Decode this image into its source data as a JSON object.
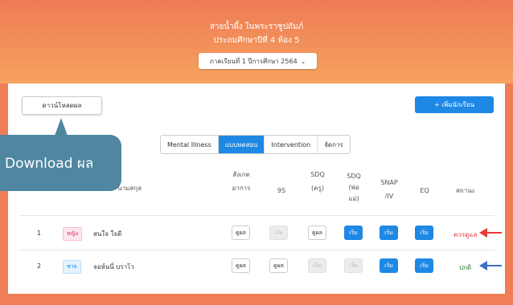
{
  "header": {
    "school": "สายน้ำผึ้ง ในพระราชูปถัมภ์",
    "class": "ประถมศึกษาปีที่ 4 ห้อง 5",
    "semester": "ภาคเรียนที่ 1 ปีการศึกษา 2564",
    "semester_caret": "⌄"
  },
  "toolbar": {
    "download_label": "ดาวน์โหลดผล",
    "add_label": "+  เพิ่มนักเรียน"
  },
  "callout": {
    "text": "Download ผล"
  },
  "tabs": [
    "Mental Illness",
    "แบบทดสอบ",
    "Intervention",
    "จัดการ"
  ],
  "columns": {
    "name": "ชื่อ-นามสกุล",
    "observe": [
      "สังเกต",
      "อาการ"
    ],
    "9s": "9S",
    "sdq_t": [
      "SDQ",
      "(ครู)"
    ],
    "sdq_p": [
      "SDQ",
      "(พ่อ",
      "แม่)"
    ],
    "snap": [
      "SNAP",
      "/IV"
    ],
    "eq": "EQ",
    "status": "สถานะ"
  },
  "rows": [
    {
      "no": "1",
      "gender": "หญิง",
      "name": "สนใจ ใจดี",
      "b": [
        "ดูผล",
        "เริ่ม",
        "ดูผล",
        "เริ่ม",
        "เริ่ม",
        "เริ่ม"
      ],
      "status": "ควรดูแล"
    },
    {
      "no": "2",
      "gender": "ชาย",
      "name": "จอห์นนี่ บราโว",
      "b": [
        "ดูผล",
        "ดูผล",
        "เริ่ม",
        "เริ่ม",
        "เริ่ม",
        "เริ่ม"
      ],
      "status": "ปกติ"
    }
  ],
  "colors": {
    "accent": "#1e88e5",
    "header": "#ef7d55",
    "warn": "#e53935",
    "ok": "#2e7d32",
    "callout": "#4f86a0"
  }
}
